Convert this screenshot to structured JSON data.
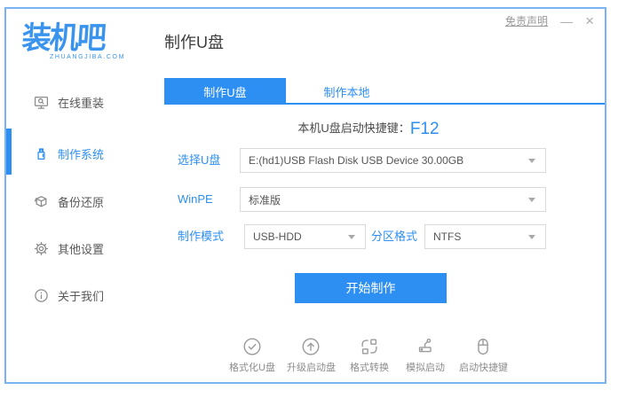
{
  "app": {
    "logo_text": "装机吧",
    "logo_subtext": "ZHUANGJIBA.COM",
    "page_title": "制作U盘"
  },
  "window_controls": {
    "disclaimer": "免责声明",
    "minimize": "—",
    "close": "×"
  },
  "sidebar": {
    "items": [
      {
        "label": "在线重装",
        "icon": "monitor-search-icon",
        "active": false
      },
      {
        "label": "制作系统",
        "icon": "usb-drive-icon",
        "active": true
      },
      {
        "label": "备份还原",
        "icon": "backup-box-icon",
        "active": false
      },
      {
        "label": "其他设置",
        "icon": "gear-icon",
        "active": false
      },
      {
        "label": "关于我们",
        "icon": "info-icon",
        "active": false
      }
    ]
  },
  "tabs": [
    {
      "label": "制作U盘",
      "active": true
    },
    {
      "label": "制作本地",
      "active": false
    }
  ],
  "form": {
    "hotkey_label": "本机U盘启动快捷键：",
    "hotkey_value": "F12",
    "usb_label": "选择U盘",
    "usb_value": "E:(hd1)USB Flash Disk USB Device 30.00GB",
    "winpe_label": "WinPE",
    "winpe_value": "标准版",
    "mode_label": "制作模式",
    "mode_value": "USB-HDD",
    "partition_label": "分区格式",
    "partition_value": "NTFS",
    "submit_label": "开始制作"
  },
  "toolbar": {
    "items": [
      {
        "label": "格式化U盘",
        "icon": "check-circle-icon"
      },
      {
        "label": "升级启动盘",
        "icon": "arrow-up-circle-icon"
      },
      {
        "label": "格式转换",
        "icon": "convert-icon"
      },
      {
        "label": "模拟启动",
        "icon": "stamp-icon"
      },
      {
        "label": "启动快捷键",
        "icon": "mouse-icon"
      }
    ]
  },
  "colors": {
    "primary": "#2e8ff2",
    "window_border": "#79b3f2"
  }
}
